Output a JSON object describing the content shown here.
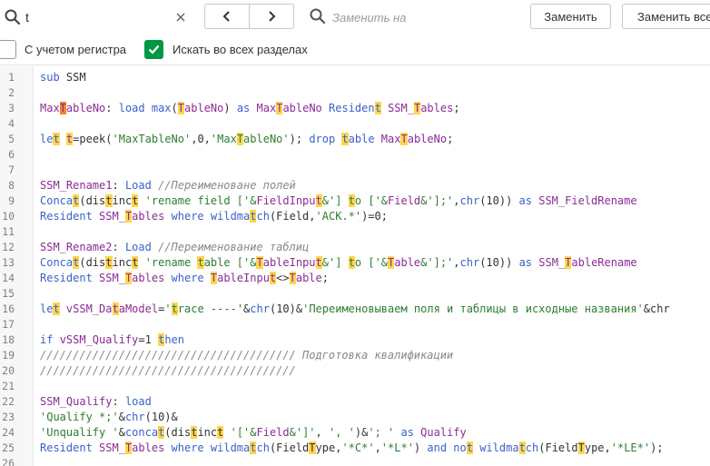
{
  "find": {
    "value": "t",
    "clear_icon": "close-icon",
    "search_icon": "search-icon"
  },
  "nav": {
    "prev_icon": "chevron-left-icon",
    "next_icon": "chevron-right-icon"
  },
  "replace": {
    "placeholder": "Заменить на",
    "icon": "search-icon"
  },
  "buttons": {
    "replace": "Заменить",
    "replace_all": "Заменить все"
  },
  "options": {
    "match_case_label": "С учетом регистра",
    "match_case_checked": false,
    "all_sections_label": "Искать во всех разделах",
    "all_sections_checked": true
  },
  "colors": {
    "accent_green": "#009845",
    "keyword": "#3a62c9",
    "variable": "#8b2b96",
    "string": "#2f7d2f",
    "comment": "#888888",
    "match_highlight": "#ffd54d",
    "current_match": "#f3842a"
  },
  "code_lines": [
    {
      "n": "1",
      "t": [
        [
          "kw",
          "sub"
        ],
        [
          "txt",
          " SSM"
        ]
      ]
    },
    {
      "n": "2",
      "t": []
    },
    {
      "n": "3",
      "t": [
        [
          "var",
          "Max"
        ],
        [
          "var-cur",
          "T"
        ],
        [
          "var",
          "ableNo"
        ],
        [
          "txt",
          ": "
        ],
        [
          "kw",
          "load "
        ],
        [
          "kw",
          "max"
        ],
        [
          "txt",
          "("
        ],
        [
          "var-hl",
          "T"
        ],
        [
          "var",
          "ableNo"
        ],
        [
          "txt",
          ") "
        ],
        [
          "kw",
          "as "
        ],
        [
          "var",
          "Max"
        ],
        [
          "var-hl",
          "T"
        ],
        [
          "var",
          "ableNo "
        ],
        [
          "kw",
          "Residen"
        ],
        [
          "kw-hl",
          "t"
        ],
        [
          "txt",
          " "
        ],
        [
          "var",
          "SSM_"
        ],
        [
          "var-hl",
          "T"
        ],
        [
          "var",
          "ables"
        ],
        [
          "txt",
          ";"
        ]
      ]
    },
    {
      "n": "4",
      "t": []
    },
    {
      "n": "5",
      "t": [
        [
          "kw",
          "le"
        ],
        [
          "kw-hl",
          "t"
        ],
        [
          "txt",
          " "
        ],
        [
          "var-hl",
          "t"
        ],
        [
          "txt",
          "=peek("
        ],
        [
          "str",
          "'MaxTableNo'"
        ],
        [
          "txt",
          ",0,"
        ],
        [
          "str",
          "'Max"
        ],
        [
          "str-hl",
          "T"
        ],
        [
          "str",
          "ableNo'"
        ],
        [
          "txt",
          "); "
        ],
        [
          "kw",
          "drop "
        ],
        [
          "kw-hl",
          "t"
        ],
        [
          "kw",
          "able "
        ],
        [
          "var",
          "Max"
        ],
        [
          "var-hl",
          "T"
        ],
        [
          "var",
          "ableNo"
        ],
        [
          "txt",
          ";"
        ]
      ]
    },
    {
      "n": "6",
      "t": []
    },
    {
      "n": "7",
      "t": []
    },
    {
      "n": "8",
      "t": [
        [
          "var",
          "SSM_Rename1"
        ],
        [
          "txt",
          ": "
        ],
        [
          "kw",
          "Load "
        ],
        [
          "cmt",
          "//Переименоване полей"
        ]
      ]
    },
    {
      "n": "9",
      "t": [
        [
          "kw",
          "Conca"
        ],
        [
          "kw-hl",
          "t"
        ],
        [
          "txt",
          "(dis"
        ],
        [
          "txt-hl",
          "t"
        ],
        [
          "txt",
          "inc"
        ],
        [
          "txt-hl",
          "t"
        ],
        [
          "txt",
          " "
        ],
        [
          "str",
          "'rename field ['&"
        ],
        [
          "var",
          "FieldInpu"
        ],
        [
          "var-hl",
          "t"
        ],
        [
          "str",
          "&'] "
        ],
        [
          "str-hl",
          "t"
        ],
        [
          "str",
          "o ['&"
        ],
        [
          "var",
          "Field"
        ],
        [
          "str",
          "&'];'"
        ],
        [
          "txt",
          ","
        ],
        [
          "kw",
          "chr"
        ],
        [
          "txt",
          "(10)) "
        ],
        [
          "kw",
          "as "
        ],
        [
          "var",
          "SSM_FieldRename"
        ]
      ]
    },
    {
      "n": "10",
      "t": [
        [
          "kw",
          "Resident "
        ],
        [
          "var",
          "SSM_"
        ],
        [
          "var-hl",
          "T"
        ],
        [
          "var",
          "ables "
        ],
        [
          "kw",
          "where "
        ],
        [
          "kw",
          "wildma"
        ],
        [
          "kw-hl",
          "t"
        ],
        [
          "kw",
          "ch"
        ],
        [
          "txt",
          "(Field,"
        ],
        [
          "str",
          "'ACK.*'"
        ],
        [
          "txt",
          ")=0;"
        ]
      ]
    },
    {
      "n": "11",
      "t": []
    },
    {
      "n": "12",
      "t": [
        [
          "var",
          "SSM_Rename2"
        ],
        [
          "txt",
          ": "
        ],
        [
          "kw",
          "Load "
        ],
        [
          "cmt",
          "//Переименование таблиц"
        ]
      ]
    },
    {
      "n": "13",
      "t": [
        [
          "kw",
          "Conca"
        ],
        [
          "kw-hl",
          "t"
        ],
        [
          "txt",
          "(dis"
        ],
        [
          "txt-hl",
          "t"
        ],
        [
          "txt",
          "inc"
        ],
        [
          "txt-hl",
          "t"
        ],
        [
          "txt",
          " "
        ],
        [
          "str",
          "'rename "
        ],
        [
          "str-hl",
          "t"
        ],
        [
          "str",
          "able ['&"
        ],
        [
          "var-hl",
          "T"
        ],
        [
          "var",
          "ableInpu"
        ],
        [
          "var-hl",
          "t"
        ],
        [
          "str",
          "&'] "
        ],
        [
          "str-hl",
          "t"
        ],
        [
          "str",
          "o ['&"
        ],
        [
          "var-hl",
          "T"
        ],
        [
          "var",
          "able"
        ],
        [
          "str",
          "&'];'"
        ],
        [
          "txt",
          ","
        ],
        [
          "kw",
          "chr"
        ],
        [
          "txt",
          "(10)) "
        ],
        [
          "kw",
          "as "
        ],
        [
          "var",
          "SSM_"
        ],
        [
          "var-hl",
          "T"
        ],
        [
          "var",
          "ableRename"
        ]
      ]
    },
    {
      "n": "14",
      "t": [
        [
          "kw",
          "Resident "
        ],
        [
          "var",
          "SSM_"
        ],
        [
          "var-hl",
          "T"
        ],
        [
          "var",
          "ables "
        ],
        [
          "kw",
          "where "
        ],
        [
          "var-hl",
          "T"
        ],
        [
          "var",
          "ableInpu"
        ],
        [
          "var-hl",
          "t"
        ],
        [
          "txt",
          "<>"
        ],
        [
          "var-hl",
          "T"
        ],
        [
          "var",
          "able"
        ],
        [
          "txt",
          ";"
        ]
      ]
    },
    {
      "n": "15",
      "t": []
    },
    {
      "n": "16",
      "t": [
        [
          "kw",
          "le"
        ],
        [
          "kw-hl",
          "t"
        ],
        [
          "txt",
          " "
        ],
        [
          "var",
          "vSSM_Da"
        ],
        [
          "var-hl",
          "t"
        ],
        [
          "var",
          "aModel"
        ],
        [
          "txt",
          "="
        ],
        [
          "str",
          "'"
        ],
        [
          "str-hl",
          "t"
        ],
        [
          "str",
          "race ----'"
        ],
        [
          "txt",
          "&"
        ],
        [
          "kw",
          "chr"
        ],
        [
          "txt",
          "(10)&"
        ],
        [
          "str",
          "'Переименовываем поля и таблицы в исходные названия'"
        ],
        [
          "txt",
          "&chr"
        ]
      ]
    },
    {
      "n": "17",
      "t": []
    },
    {
      "n": "18",
      "t": [
        [
          "kw",
          "if "
        ],
        [
          "var",
          "vSSM_Qualify"
        ],
        [
          "txt",
          "=1 "
        ],
        [
          "kw-hl",
          "t"
        ],
        [
          "kw",
          "hen"
        ]
      ]
    },
    {
      "n": "19",
      "t": [
        [
          "cmt",
          "/////////////////////////////////////// Подготовка квалификации"
        ]
      ]
    },
    {
      "n": "20",
      "t": [
        [
          "cmt",
          "///////////////////////////////////////"
        ]
      ]
    },
    {
      "n": "21",
      "t": []
    },
    {
      "n": "22",
      "t": [
        [
          "var",
          "SSM_Qualify"
        ],
        [
          "txt",
          ": "
        ],
        [
          "kw",
          "load"
        ]
      ]
    },
    {
      "n": "23",
      "t": [
        [
          "str",
          "'Qualify *;'"
        ],
        [
          "txt",
          "&"
        ],
        [
          "kw",
          "chr"
        ],
        [
          "txt",
          "(10)&"
        ]
      ]
    },
    {
      "n": "24",
      "t": [
        [
          "str",
          "'Unqualify '"
        ],
        [
          "txt",
          "&"
        ],
        [
          "kw",
          "conca"
        ],
        [
          "kw-hl",
          "t"
        ],
        [
          "txt",
          "(dis"
        ],
        [
          "txt-hl",
          "t"
        ],
        [
          "txt",
          "inc"
        ],
        [
          "txt-hl",
          "t"
        ],
        [
          "txt",
          " "
        ],
        [
          "str",
          "'['&"
        ],
        [
          "var",
          "Field"
        ],
        [
          "str",
          "&']'"
        ],
        [
          "txt",
          ", "
        ],
        [
          "str",
          "', '"
        ],
        [
          "txt",
          ")&"
        ],
        [
          "str",
          "'; '"
        ],
        [
          "txt",
          " "
        ],
        [
          "kw",
          "as "
        ],
        [
          "var",
          "Qualify"
        ]
      ]
    },
    {
      "n": "25",
      "t": [
        [
          "kw",
          "Resident "
        ],
        [
          "var",
          "SSM_"
        ],
        [
          "var-hl",
          "T"
        ],
        [
          "var",
          "ables "
        ],
        [
          "kw",
          "where "
        ],
        [
          "kw",
          "wildma"
        ],
        [
          "kw-hl",
          "t"
        ],
        [
          "kw",
          "ch"
        ],
        [
          "txt",
          "(Field"
        ],
        [
          "txt-hl",
          "T"
        ],
        [
          "txt",
          "ype,"
        ],
        [
          "str",
          "'*C*'"
        ],
        [
          "txt",
          ","
        ],
        [
          "str",
          "'*L*'"
        ],
        [
          "txt",
          ") "
        ],
        [
          "kw",
          "and "
        ],
        [
          "kw",
          "no"
        ],
        [
          "kw-hl",
          "t"
        ],
        [
          "txt",
          " "
        ],
        [
          "kw",
          "wildma"
        ],
        [
          "kw-hl",
          "t"
        ],
        [
          "kw",
          "ch"
        ],
        [
          "txt",
          "(Field"
        ],
        [
          "txt-hl",
          "T"
        ],
        [
          "txt",
          "ype,"
        ],
        [
          "str",
          "'*LE*'"
        ],
        [
          "txt",
          ");"
        ]
      ]
    },
    {
      "n": "26",
      "t": []
    }
  ]
}
